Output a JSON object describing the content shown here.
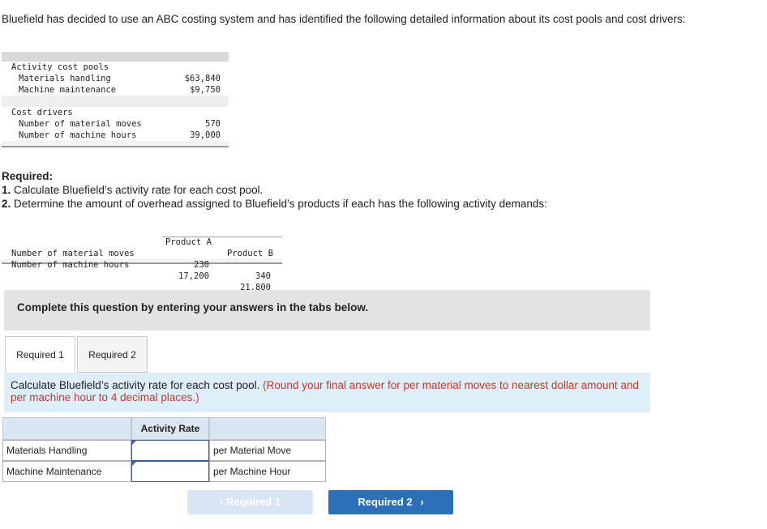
{
  "intro": "Bluefield has decided to use an ABC costing system and has identified the following detailed information about its cost pools and cost drivers:",
  "pools_table": {
    "pools_header": "Activity cost pools",
    "pools": [
      {
        "label": "Materials handling",
        "value": "$63,840"
      },
      {
        "label": "Machine maintenance",
        "value": "$9,750"
      }
    ],
    "drivers_header": "Cost drivers",
    "drivers": [
      {
        "label": "Number of material moves",
        "value": "570"
      },
      {
        "label": "Number of machine hours",
        "value": "39,000"
      }
    ]
  },
  "required": {
    "heading": "Required:",
    "item1_num": "1.",
    "item1": " Calculate Bluefield’s activity rate for each cost pool.",
    "item2_num": "2.",
    "item2": " Determine the amount of overhead assigned to Bluefield’s products if each has the following activity demands:"
  },
  "demand_table": {
    "col_a": "Product A",
    "col_b": "Product B",
    "rows": [
      {
        "label": "Number of material moves",
        "a": "230",
        "b": "340"
      },
      {
        "label": "Number of machine hours",
        "a": "17,200",
        "b": "21,800"
      }
    ]
  },
  "instruction": "Complete this question by entering your answers in the tabs below.",
  "tabs": [
    {
      "label": "Required 1",
      "active": true
    },
    {
      "label": "Required 2",
      "active": false
    }
  ],
  "prompt": {
    "text": "Calculate Bluefield’s activity rate for each cost pool. ",
    "note": "(Round your final answer for per material moves to nearest dollar amount and per machine hour to 4 decimal places.)"
  },
  "answer_table": {
    "header": "Activity Rate",
    "rows": [
      {
        "label": "Materials Handling",
        "value": "",
        "unit": "per Material Move"
      },
      {
        "label": "Machine Maintenance",
        "value": "",
        "unit": "per Machine Hour"
      }
    ]
  },
  "nav": {
    "prev_label": "Required 1",
    "next_label": "Required 2",
    "prev_chevron": "‹",
    "next_chevron": "›"
  },
  "colors": {
    "accent": "#2c6fb7",
    "prompt_bg": "#deeef9",
    "note": "#c0392b"
  }
}
